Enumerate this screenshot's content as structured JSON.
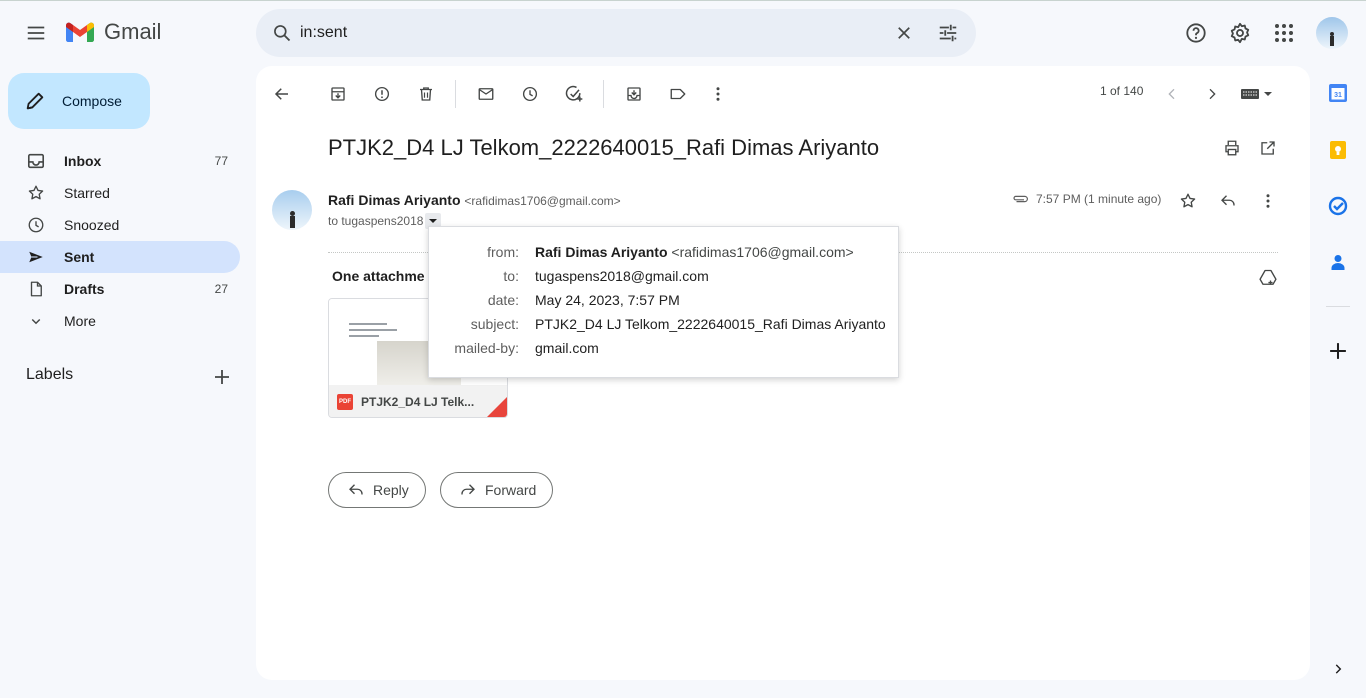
{
  "app": {
    "name": "Gmail"
  },
  "search": {
    "query": "in:sent"
  },
  "sidebar": {
    "compose_label": "Compose",
    "items": [
      {
        "label": "Inbox",
        "count": "77"
      },
      {
        "label": "Starred",
        "count": ""
      },
      {
        "label": "Snoozed",
        "count": ""
      },
      {
        "label": "Sent",
        "count": ""
      },
      {
        "label": "Drafts",
        "count": "27"
      },
      {
        "label": "More",
        "count": ""
      }
    ],
    "labels_heading": "Labels"
  },
  "toolbar": {
    "pagination": "1 of 140"
  },
  "email": {
    "subject": "PTJK2_D4 LJ Telkom_2222640015_Rafi Dimas Ariyanto",
    "sender_name": "Rafi Dimas Ariyanto",
    "sender_email": "<rafidimas1706@gmail.com>",
    "to_line": "to tugaspens2018",
    "time": "7:57 PM (1 minute ago)",
    "attachments_heading": "One attachme",
    "attachment_name": "PTJK2_D4 LJ Telk...",
    "reply_label": "Reply",
    "forward_label": "Forward"
  },
  "details_popup": {
    "from_key": "from:",
    "from_name": "Rafi Dimas Ariyanto",
    "from_email": "<rafidimas1706@gmail.com>",
    "to_key": "to:",
    "to_value": "tugaspens2018@gmail.com",
    "date_key": "date:",
    "date_value": "May 24, 2023, 7:57 PM",
    "subject_key": "subject:",
    "subject_value": "PTJK2_D4 LJ Telkom_2222640015_Rafi Dimas Ariyanto",
    "mailedby_key": "mailed-by:",
    "mailedby_value": "gmail.com"
  },
  "colors": {
    "active_nav": "#d3e3fd",
    "compose_bg": "#c2e7ff",
    "search_bg": "#e9eef6",
    "page_bg": "#f6f8fc"
  },
  "icons": [
    "menu-icon",
    "gmail-logo",
    "search-icon",
    "clear-icon",
    "search-options-icon",
    "help-icon",
    "settings-icon",
    "apps-icon",
    "back-icon",
    "archive-icon",
    "report-spam-icon",
    "delete-icon",
    "mark-unread-icon",
    "snooze-icon",
    "add-task-icon",
    "move-to-icon",
    "label-icon",
    "more-vert-icon",
    "chevron-left-icon",
    "chevron-right-icon",
    "input-tools-icon",
    "print-icon",
    "open-new-window-icon",
    "attachment-clip-icon",
    "star-icon",
    "reply-icon",
    "add-to-drive-icon",
    "calendar-icon",
    "keep-icon",
    "tasks-icon",
    "contacts-icon",
    "plus-icon"
  ]
}
